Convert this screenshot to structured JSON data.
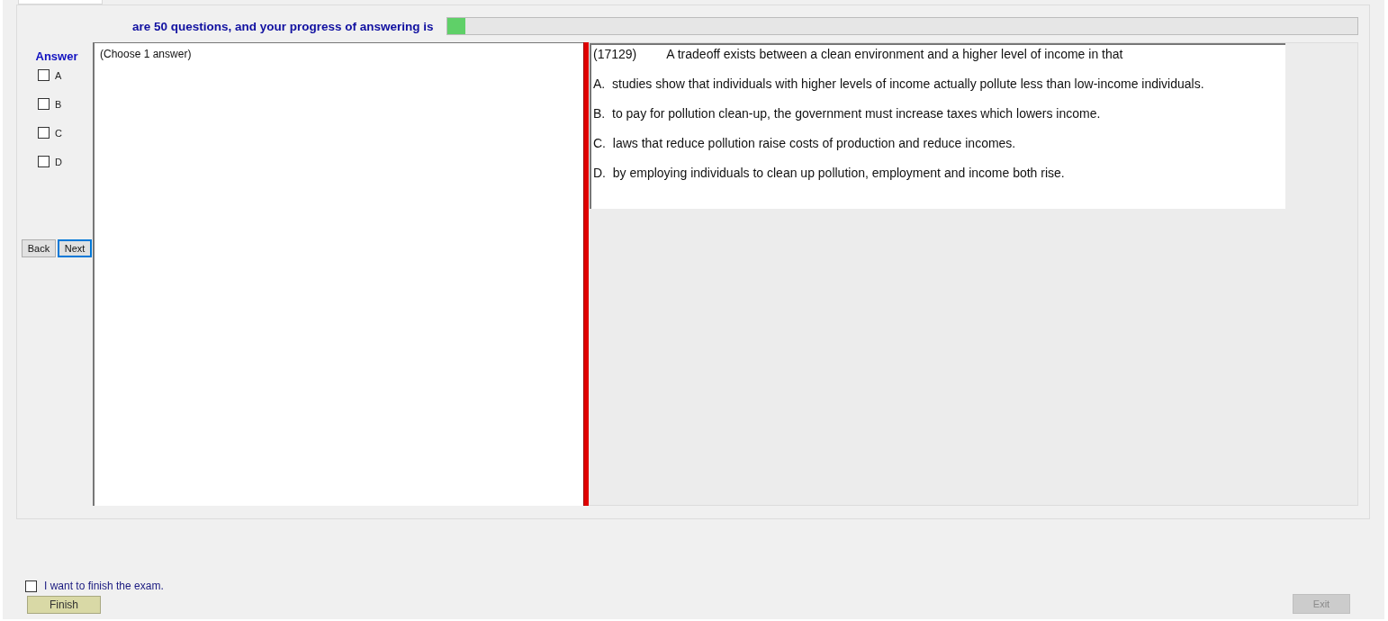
{
  "header": {
    "text": "are 50 questions, and your progress of answering is",
    "progress": {
      "level": 0.02
    }
  },
  "answer": {
    "title": "Answer",
    "options": [
      {
        "label": "A",
        "checked": false
      },
      {
        "label": "B",
        "checked": false
      },
      {
        "label": "C",
        "checked": false
      },
      {
        "label": "D",
        "checked": false
      }
    ]
  },
  "nav_buttons": [
    {
      "label": "Back",
      "focused": false
    },
    {
      "label": "Next",
      "focused": true
    }
  ],
  "answer_panel": {
    "hint": "(Choose 1 answer)"
  },
  "question": {
    "number": "(17129)",
    "text": "A tradeoff exists between a clean environment and a higher level of income in that",
    "choices": [
      "A.  studies show that individuals with higher levels of income actually pollute less than low-income individuals.",
      "B.  to pay for pollution clean-up, the government must increase taxes which lowers income.",
      "C.  laws that reduce pollution raise costs of production and reduce incomes.",
      "D.  by employing individuals to clean up pollution, employment and income both rise."
    ]
  },
  "finish": {
    "label": "I want to finish the exam.",
    "checked": false,
    "button": "Finish"
  },
  "exit_button": {
    "label": "Exit",
    "disabled": true
  }
}
